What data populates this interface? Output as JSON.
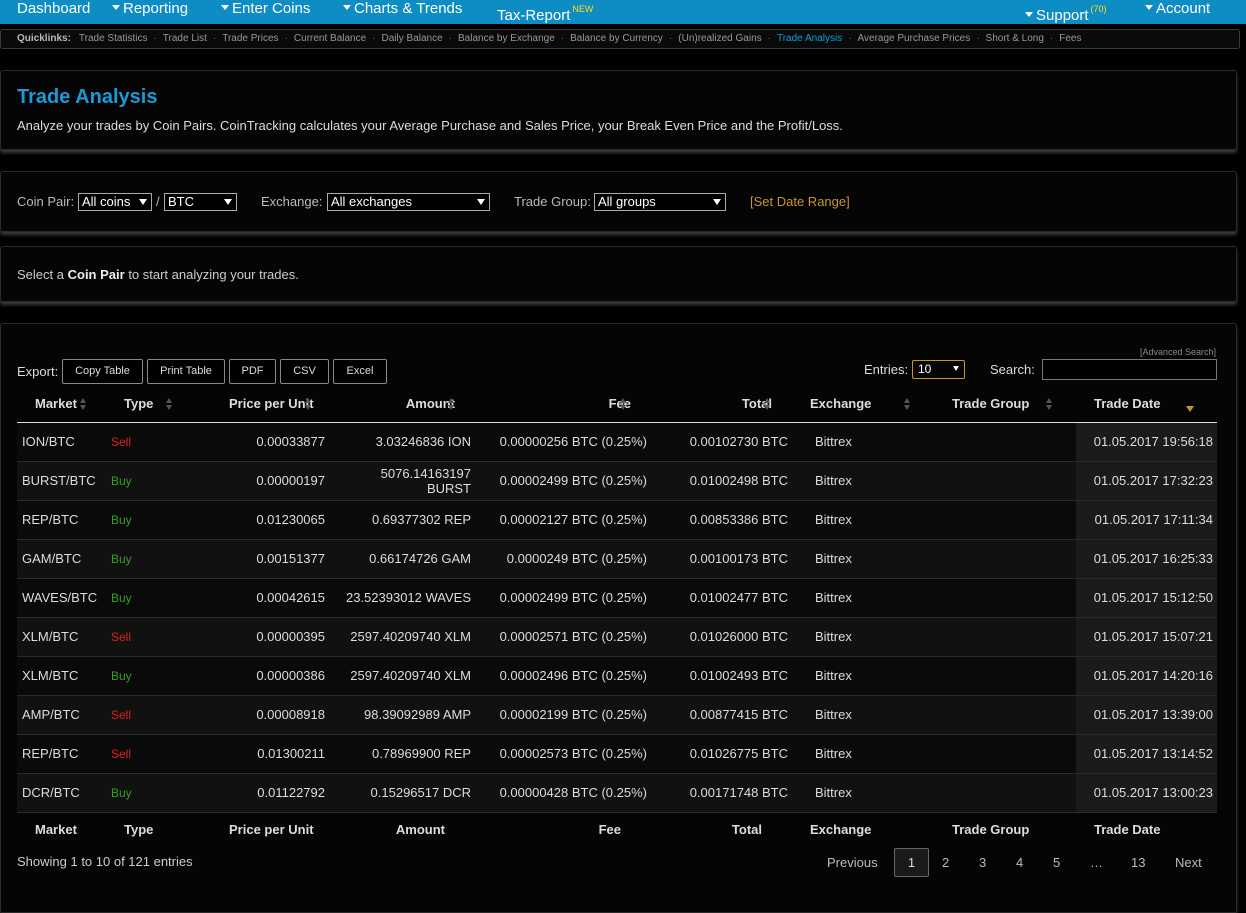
{
  "nav": {
    "dashboard": "Dashboard",
    "reporting": "Reporting",
    "enter_coins": "Enter Coins",
    "charts": "Charts & Trends",
    "tax_report": "Tax-Report",
    "tax_badge": "NEW",
    "support": "Support",
    "support_count": "(70)",
    "account": "Account"
  },
  "quicklinks": {
    "label": "Quicklinks:",
    "items": [
      "Trade Statistics",
      "Trade List",
      "Trade Prices",
      "Current Balance",
      "Daily Balance",
      "Balance by Exchange",
      "Balance by Currency",
      "(Un)realized Gains",
      "Trade Analysis",
      "Average Purchase Prices",
      "Short & Long",
      "Fees"
    ],
    "active": "Trade Analysis"
  },
  "header": {
    "title": "Trade Analysis",
    "subtitle": "Analyze your trades by Coin Pairs. CoinTracking calculates your Average Purchase and Sales Price, your Break Even Price and the Profit/Loss."
  },
  "filters": {
    "coin_pair_label": "Coin Pair:",
    "coin_value": "All coins",
    "slash": "/",
    "base_value": "BTC",
    "exchange_label": "Exchange:",
    "exchange_value": "All exchanges",
    "group_label": "Trade Group:",
    "group_value": "All groups",
    "date_range": "[Set Date Range]"
  },
  "info": {
    "prefix": "Select a",
    "bold": "Coin Pair",
    "suffix": "to start analyzing your trades."
  },
  "toolbar": {
    "export_label": "Export:",
    "copy": "Copy Table",
    "print": "Print Table",
    "pdf": "PDF",
    "csv": "CSV",
    "excel": "Excel",
    "advanced_search": "[Advanced Search]",
    "entries_label": "Entries:",
    "entries_value": "10",
    "search_label": "Search:",
    "search_value": ""
  },
  "table": {
    "headers": [
      "Market",
      "Type",
      "Price per Unit",
      "Amount",
      "Fee",
      "Total",
      "Exchange",
      "Trade Group",
      "Trade Date"
    ],
    "rows": [
      [
        "ION/BTC",
        "Sell",
        "0.00033877",
        "3.03246836 ION",
        "0.00000256 BTC (0.25%)",
        "0.00102730 BTC",
        "Bittrex",
        "",
        "01.05.2017 19:56:18"
      ],
      [
        "BURST/BTC",
        "Buy",
        "0.00000197",
        "5076.14163197 BURST",
        "0.00002499 BTC (0.25%)",
        "0.01002498 BTC",
        "Bittrex",
        "",
        "01.05.2017 17:32:23"
      ],
      [
        "REP/BTC",
        "Buy",
        "0.01230065",
        "0.69377302 REP",
        "0.00002127 BTC (0.25%)",
        "0.00853386 BTC",
        "Bittrex",
        "",
        "01.05.2017 17:11:34"
      ],
      [
        "GAM/BTC",
        "Buy",
        "0.00151377",
        "0.66174726 GAM",
        "0.0000249 BTC (0.25%)",
        "0.00100173 BTC",
        "Bittrex",
        "",
        "01.05.2017 16:25:33"
      ],
      [
        "WAVES/BTC",
        "Buy",
        "0.00042615",
        "23.52393012 WAVES",
        "0.00002499 BTC (0.25%)",
        "0.01002477 BTC",
        "Bittrex",
        "",
        "01.05.2017 15:12:50"
      ],
      [
        "XLM/BTC",
        "Sell",
        "0.00000395",
        "2597.40209740 XLM",
        "0.00002571 BTC (0.25%)",
        "0.01026000 BTC",
        "Bittrex",
        "",
        "01.05.2017 15:07:21"
      ],
      [
        "XLM/BTC",
        "Buy",
        "0.00000386",
        "2597.40209740 XLM",
        "0.00002496 BTC (0.25%)",
        "0.01002493 BTC",
        "Bittrex",
        "",
        "01.05.2017 14:20:16"
      ],
      [
        "AMP/BTC",
        "Sell",
        "0.00008918",
        "98.39092989 AMP",
        "0.00002199 BTC (0.25%)",
        "0.00877415 BTC",
        "Bittrex",
        "",
        "01.05.2017 13:39:00"
      ],
      [
        "REP/BTC",
        "Sell",
        "0.01300211",
        "0.78969900 REP",
        "0.00002573 BTC (0.25%)",
        "0.01026775 BTC",
        "Bittrex",
        "",
        "01.05.2017 13:14:52"
      ],
      [
        "DCR/BTC",
        "Buy",
        "0.01122792",
        "0.15296517 DCR",
        "0.00000428 BTC (0.25%)",
        "0.00171748 BTC",
        "Bittrex",
        "",
        "01.05.2017 13:00:23"
      ]
    ]
  },
  "footer": {
    "showing": "Showing 1 to 10 of 121 entries",
    "previous": "Previous",
    "pages": [
      "1",
      "2",
      "3",
      "4",
      "5",
      "…",
      "13"
    ],
    "next": "Next"
  },
  "colors": {
    "accent": "#1a9ad6",
    "nav_bg": "#0e8dc4",
    "sell": "#e0201b",
    "buy": "#3a9a2a",
    "link_gold": "#c8962a"
  }
}
